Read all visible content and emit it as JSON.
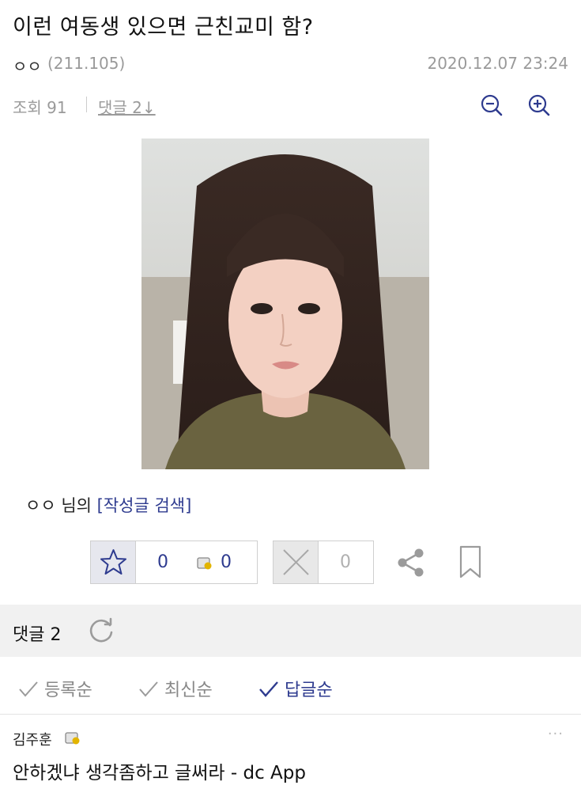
{
  "post": {
    "title": "이런 여동생 있으면 근친교미 함?",
    "author": "ㅇㅇ",
    "ip": "(211.105)",
    "date": "2020.12.07 23:24",
    "views_label": "조회 91",
    "comments_link": "댓글 2↓"
  },
  "author_search": {
    "name": "ㅇㅇ 님의",
    "link": "[작성글 검색]"
  },
  "votes": {
    "up_count": "0",
    "fix_up_count": "0",
    "down_count": "0"
  },
  "comments_section": {
    "label": "댓글 2",
    "sort_options": [
      "등록순",
      "최신순",
      "답글순"
    ],
    "active_sort": "답글순"
  },
  "comments": [
    {
      "author": "김주훈",
      "more": "···",
      "text": "안하겠냐 생각좀하고 글써라 - dc App"
    }
  ],
  "colors": {
    "accent": "#2e3b8f",
    "muted": "#9a9a9a",
    "bar_bg": "#f1f1f1"
  },
  "icons": [
    "zoom-out-icon",
    "zoom-in-icon",
    "star-icon",
    "fixed-user-icon",
    "x-icon",
    "share-icon",
    "bookmark-icon",
    "refresh-icon",
    "check-icon"
  ]
}
